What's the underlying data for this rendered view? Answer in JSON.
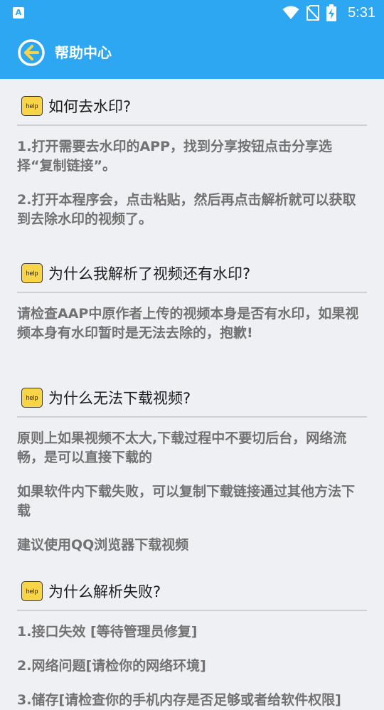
{
  "status_bar": {
    "app_icon_glyph": "A",
    "time": "5:31",
    "icons": [
      "wifi-icon",
      "no-sim-icon",
      "battery-charging-icon"
    ]
  },
  "app_bar": {
    "title": "帮助中心",
    "back_icon": "back-arrow-icon"
  },
  "badge_text": "help",
  "sections": [
    {
      "question": "如何去水印?",
      "answers": [
        "1.打开需要去水印的APP，找到分享按钮点击分享选择“复制链接”。",
        "2.打开本程序会，点击粘贴，然后再点击解析就可以获取到去除水印的视频了。"
      ]
    },
    {
      "question": "为什么我解析了视频还有水印?",
      "answers": [
        "请检查AAP中原作者上传的视频本身是否有水印，如果视频本身有水印暂时是无法去除的，抱歉!"
      ]
    },
    {
      "question": "为什么无法下载视频?",
      "answers": [
        "原则上如果视频不太大,下载过程中不要切后台，网络流畅，是可以直接下载的",
        "如果软件内下载失败，可以复制下载链接通过其他方法下载",
        "建议使用QQ浏览器下载视频"
      ]
    },
    {
      "question": "为什么解析失败?",
      "answers": [
        "1.接口失效 [等待管理员修复]",
        "2.网络问题[请检你的网络环境]",
        "3.储存[请检查你的手机内存是否足够或者给软件权限]"
      ]
    }
  ],
  "colors": {
    "primary": "#2ea7f2",
    "badge": "#f8d448",
    "answer_text": "#727272",
    "question_text": "#1c1c1c",
    "background": "#eff0f4"
  }
}
